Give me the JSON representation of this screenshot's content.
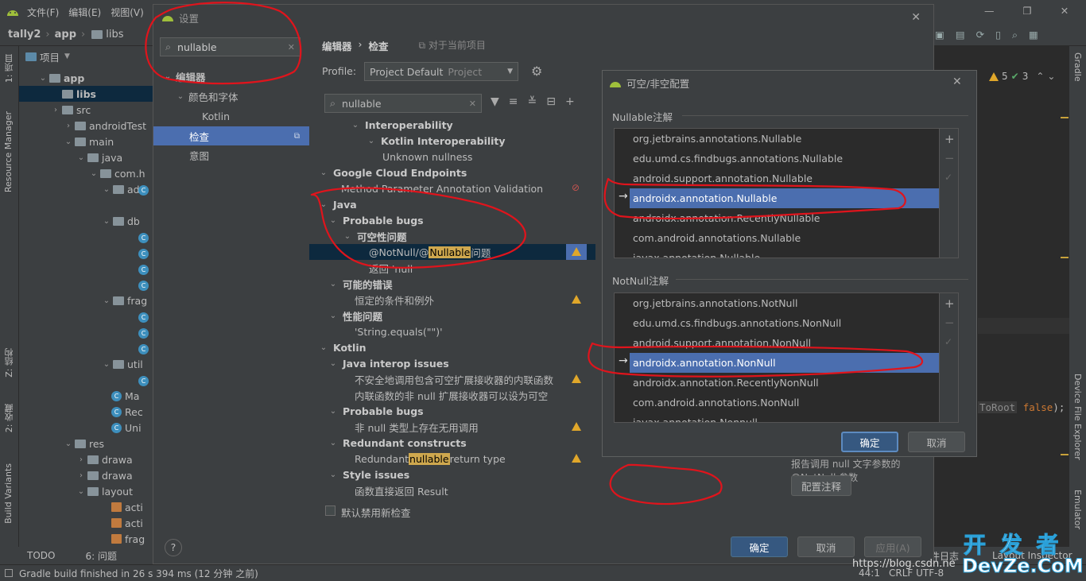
{
  "menubar": {
    "items": [
      "文件(F)",
      "编辑(E)",
      "视图(V)"
    ]
  },
  "navbar": {
    "project": "tally2",
    "module": "app",
    "folder": "libs"
  },
  "left_strip": {
    "project_tab": "1: 项目",
    "resource_manager": "Resource Manager",
    "structure": "Z: 结构",
    "favorites": "2: 收藏",
    "build_variants": "Build Variants"
  },
  "right_strip": {
    "gradle": "Gradle",
    "device_file_explorer": "Device File Explorer",
    "emulator": "Emulator"
  },
  "project_panel": {
    "title": "项目",
    "tree": [
      "app",
      "libs",
      "src",
      "androidTest",
      "main",
      "java",
      "com.h",
      "ada",
      "db",
      "frag",
      "util",
      "Ma",
      "Rec",
      "Uni",
      "res",
      "drawa",
      "drawa",
      "layout",
      "acti",
      "acti",
      "frag"
    ]
  },
  "editor": {
    "warnings": "5",
    "checks": "3",
    "code_fragment": "ToRoot",
    "code_keyword": "false",
    "code_tail": ");"
  },
  "bottom_bar": {
    "todo": "TODO",
    "problems": "6: 问题",
    "right_log": "件日志",
    "layout_inspector": "Layout Inspector"
  },
  "status_bar": {
    "message": "Gradle build finished in 26 s 394 ms (12 分钟 之前)",
    "encoding": "CRLF  UTF-8",
    "position": "44:1"
  },
  "settings_dialog": {
    "title": "设置",
    "search_value": "nullable",
    "left_items": [
      "编辑器",
      "颜色和字体",
      "Kotlin",
      "检查",
      "意图"
    ],
    "breadcrumb_parent": "编辑器",
    "breadcrumb_current": "检查",
    "scope_note": "对于当前项目",
    "profile_label": "Profile:",
    "profile_value": "Project Default",
    "profile_scope": "Project",
    "filter_value": "nullable",
    "inspection_rows": [
      {
        "text": "Interoperability",
        "bold": true
      },
      {
        "text": "Kotlin Interoperability",
        "bold": true
      },
      {
        "text": "Unknown nullness",
        "bold": false
      },
      {
        "text": "Google Cloud Endpoints",
        "bold": true
      },
      {
        "text": "Method Parameter Annotation Validation",
        "bold": false
      },
      {
        "text": "Java",
        "bold": true
      },
      {
        "text": "Probable bugs",
        "bold": true
      },
      {
        "text": "可空性问题",
        "bold": true
      },
      {
        "text": "@NotNull/@",
        "highlight": "Nullable",
        "suffix": " 问题",
        "bold": false
      },
      {
        "text": "返回 'null",
        "bold": false
      },
      {
        "text": "可能的错误",
        "bold": true
      },
      {
        "text": "恒定的条件和例外",
        "bold": false
      },
      {
        "text": "性能问题",
        "bold": true
      },
      {
        "text": "'String.equals(\"\")'",
        "bold": false
      },
      {
        "text": "Kotlin",
        "bold": true
      },
      {
        "text": "Java interop issues",
        "bold": true
      },
      {
        "text": "不安全地调用包含可空扩展接收器的内联函数",
        "bold": false
      },
      {
        "text": "内联函数的非 null 扩展接收器可以设为可空",
        "bold": false
      },
      {
        "text": "Probable bugs",
        "bold": true
      },
      {
        "text": "非 null 类型上存在无用调用",
        "bold": false
      },
      {
        "text": "Redundant constructs",
        "bold": true
      },
      {
        "text": "Redundant ",
        "highlight": "nullable",
        "suffix": " return type",
        "bold": false
      },
      {
        "text": "Style issues",
        "bold": true
      },
      {
        "text": "函数直接返回 Result",
        "bold": false
      }
    ],
    "disable_new_label": "默认禁用新检查",
    "report_option": "报告调用 null 文字参数的 @NotNull 参数",
    "configure_button": "配置注释",
    "ok_button": "确定",
    "cancel_button": "取消",
    "apply_button": "应用(A)",
    "help_button": "?"
  },
  "nullness_dialog": {
    "title": "可空/非空配置",
    "nullable_header": "Nullable注解",
    "nullable_items": [
      "org.jetbrains.annotations.Nullable",
      "edu.umd.cs.findbugs.annotations.Nullable",
      "android.support.annotation.Nullable",
      "androidx.annotation.Nullable",
      "androidx.annotation.RecentlyNullable",
      "com.android.annotations.Nullable",
      "javax.annotation.Nullable"
    ],
    "notnull_header": "NotNull注解",
    "notnull_items": [
      "org.jetbrains.annotations.NotNull",
      "edu.umd.cs.findbugs.annotations.NonNull",
      "android.support.annotation.NonNull",
      "androidx.annotation.NonNull",
      "androidx.annotation.RecentlyNonNull",
      "com.android.annotations.NonNull",
      "javax.annotation.Nonnull"
    ],
    "ok_button": "确定",
    "cancel_button": "取消"
  },
  "watermark": {
    "cn": "开 发 者",
    "en": "DevZe.CoM",
    "url": "https://blog.csdn.ne"
  },
  "colors": {
    "accent": "#4b6eaf",
    "annotation_red": "#e0141c",
    "warning": "#e0a72a",
    "highlight": "#cfa84e"
  }
}
